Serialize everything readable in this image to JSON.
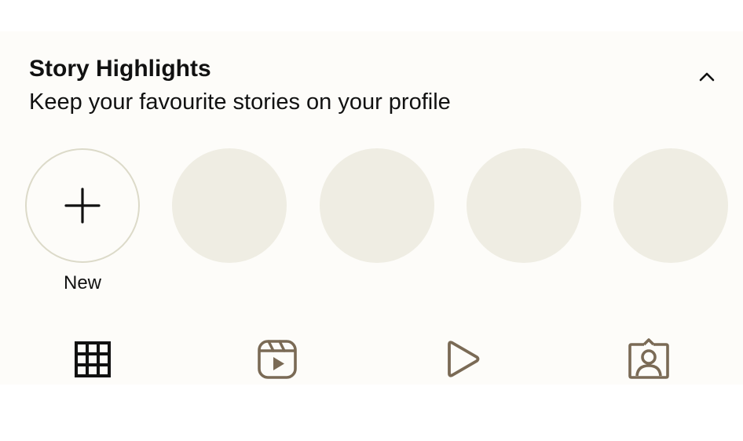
{
  "highlights": {
    "title": "Story Highlights",
    "subtitle": "Keep your favourite stories on your profile",
    "new_label": "New",
    "collapse_icon": "chevron-up-icon",
    "placeholder_count": 4
  },
  "tabs": [
    {
      "name": "posts",
      "icon": "grid-icon",
      "active": true
    },
    {
      "name": "reels",
      "icon": "reels-icon",
      "active": false
    },
    {
      "name": "videos",
      "icon": "play-icon",
      "active": false
    },
    {
      "name": "tagged",
      "icon": "tagged-person-icon",
      "active": false
    }
  ],
  "colors": {
    "background": "#fdfcf9",
    "placeholder": "#efede3",
    "active_tab": "#111111",
    "inactive_tab": "#7a6a55"
  }
}
